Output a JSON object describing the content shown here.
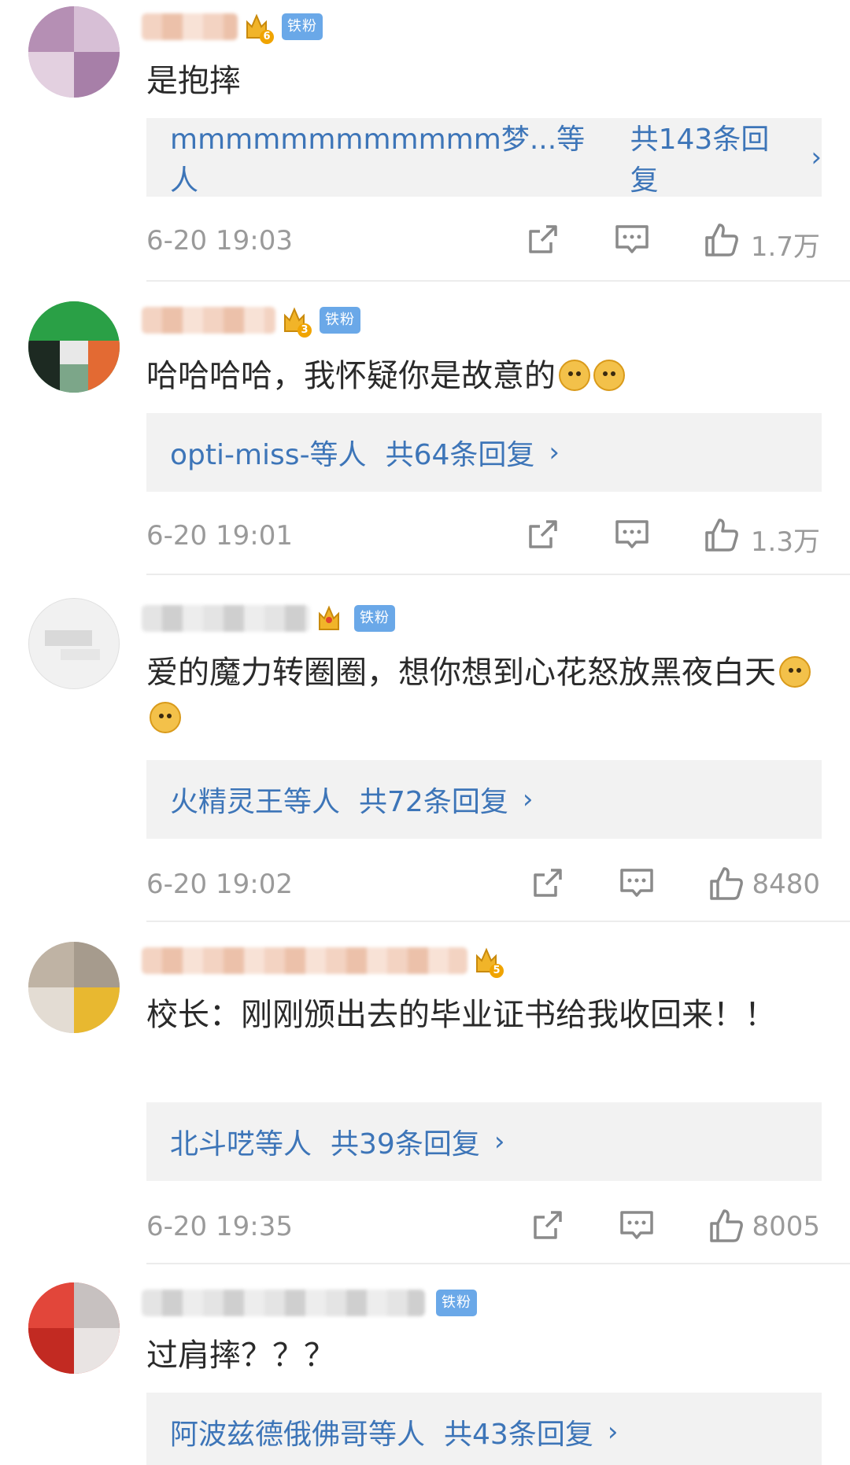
{
  "badge_label": "铁粉",
  "colors": {
    "link": "#3d75b8",
    "badge": "#6aa8e8",
    "meta": "#9a9a9a",
    "reply_bg": "#f2f2f2"
  },
  "comments": [
    {
      "level": "6",
      "text": "是抱摔",
      "reply_from": "mmmmmmmmmmmm梦...等人",
      "reply_total": "共143条回复",
      "time": "6-20 19:03",
      "likes": "1.7万"
    },
    {
      "level": "3",
      "text": "哈哈哈哈，我怀疑你是故意的",
      "reply_from": "opti-miss-等人",
      "reply_total": "共64条回复",
      "time": "6-20 19:01",
      "likes": "1.3万"
    },
    {
      "level": "",
      "text": "爱的魔力转圈圈，想你想到心花怒放黑夜白天",
      "reply_from": "火精灵王等人",
      "reply_total": "共72条回复",
      "time": "6-20 19:02",
      "likes": "8480"
    },
    {
      "level": "5",
      "text": "校长：刚刚颁出去的毕业证书给我收回来！！",
      "reply_from": "北斗呓等人",
      "reply_total": "共39条回复",
      "time": "6-20 19:35",
      "likes": "8005"
    },
    {
      "level": "",
      "text": "过肩摔？？？",
      "reply_from": "阿波兹德俄佛哥等人",
      "reply_total": "共43条回复"
    }
  ]
}
